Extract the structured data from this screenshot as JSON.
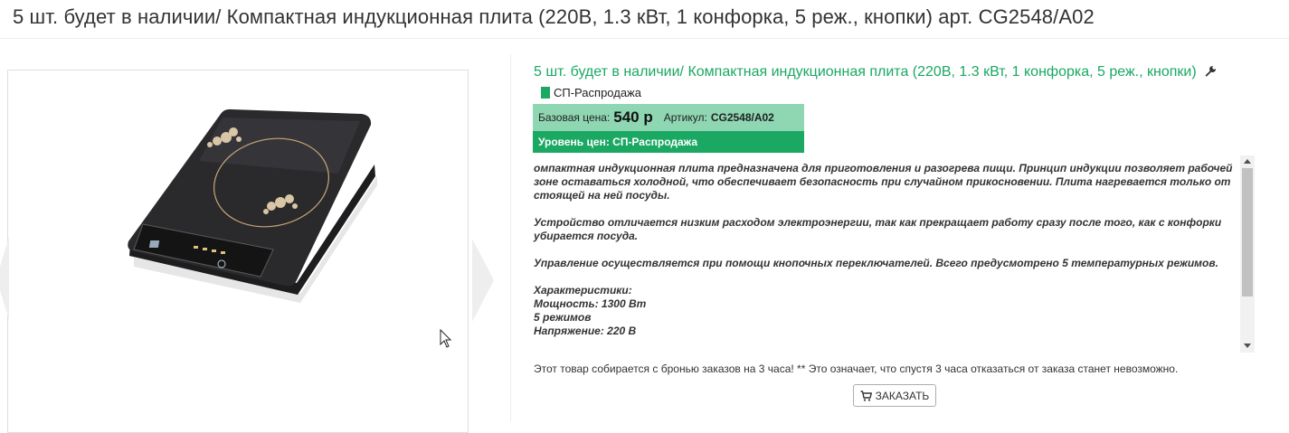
{
  "page": {
    "title": "5 шт. будет в наличии/ Компактная индукционная плита (220В, 1.3 кВт, 1 конфорка, 5 реж., кнопки) арт. CG2548/A02"
  },
  "product": {
    "name": "5 шт. будет в наличии/ Компактная индукционная плита (220В, 1.3 кВт, 1 конфорка, 5 реж., кнопки)",
    "badge_label": "СП-Распродажа",
    "icons": [
      "wrench-icon",
      "cart-icon"
    ],
    "colors": {
      "accent": "#1aa862",
      "price_bg": "#8fd6b3"
    }
  },
  "price": {
    "base_label": "Базовая цена:",
    "base_value": "540 р",
    "article_label": "Артикул:",
    "article_value": "CG2548/A02",
    "level_text": "Уровень цен: СП-Распродажа"
  },
  "description": {
    "p1": "омпактная индукционная плита предназначена для приготовления и разогрева пищи. Принцип индукции позволяет рабочей зоне оставаться холодной, что обеспечивает безопасность при случайном прикосновении. Плита нагревается только от стоящей на ней посуды.",
    "p2": "Устройство отличается низким расходом электроэнергии, так как прекращает работу сразу после того, как с конфорки убирается посуда.",
    "p3": "Управление осуществляется при помощи кнопочных переключателей. Всего предусмотрено 5 температурных режимов.",
    "spec_title": "Характеристики:",
    "spec_power": "Мощность: 1300 Вт",
    "spec_modes": "5 режимов",
    "spec_voltage": "Напряжение: 220 В"
  },
  "notice": "Этот товар собирается с бронью заказов на 3 часа! ** Это означает, что спустя 3 часа отказаться от заказа станет невозможно.",
  "order_button": {
    "label": "ЗАКАЗАТЬ"
  }
}
